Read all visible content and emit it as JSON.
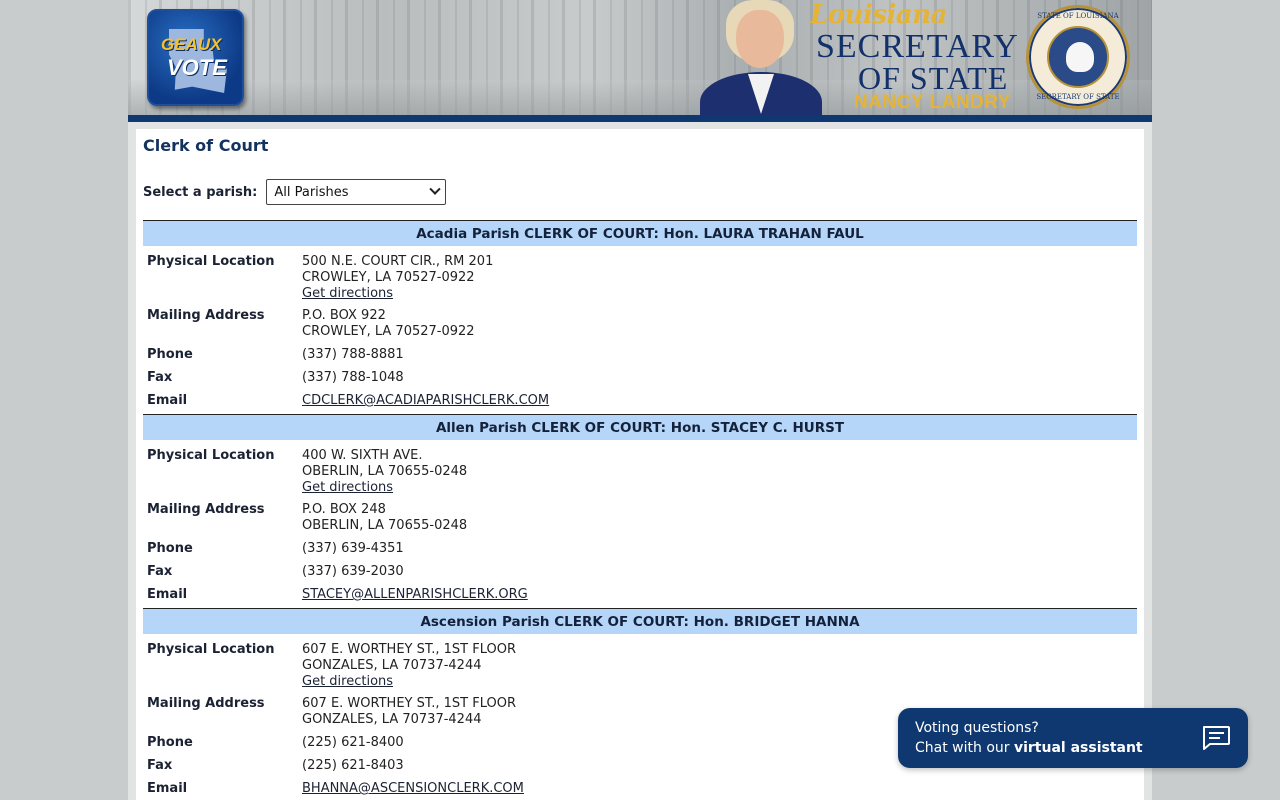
{
  "header": {
    "logo_line1": "GEAUX",
    "logo_line2": "VOTE",
    "sos_script": "Louisiana",
    "sos_line1": "SECRETARY",
    "sos_line2": "OF STATE",
    "sos_name": "NANCY LANDRY",
    "seal_top": "STATE OF LOUISIANA",
    "seal_bottom": "SECRETARY OF STATE"
  },
  "page": {
    "title": "Clerk of Court",
    "select_label": "Select a parish:",
    "select_value": "All Parishes"
  },
  "labels": {
    "physical": "Physical Location",
    "mailing": "Mailing Address",
    "phone": "Phone",
    "fax": "Fax",
    "email": "Email",
    "directions": "Get directions"
  },
  "parishes": [
    {
      "heading": "Acadia Parish CLERK OF COURT: Hon. LAURA TRAHAN FAUL",
      "phys1": "500 N.E. COURT CIR., RM 201",
      "phys2": "CROWLEY, LA 70527-0922",
      "mail1": "P.O. BOX 922",
      "mail2": "CROWLEY, LA 70527-0922",
      "phone": "(337) 788-8881",
      "fax": "(337) 788-1048",
      "email": "CDCLERK@ACADIAPARISHCLERK.COM"
    },
    {
      "heading": "Allen Parish CLERK OF COURT: Hon. STACEY C. HURST",
      "phys1": "400 W. SIXTH AVE.",
      "phys2": "OBERLIN, LA 70655-0248",
      "mail1": "P.O. BOX 248",
      "mail2": "OBERLIN, LA 70655-0248",
      "phone": "(337) 639-4351",
      "fax": "(337) 639-2030",
      "email": "STACEY@ALLENPARISHCLERK.ORG"
    },
    {
      "heading": "Ascension Parish CLERK OF COURT: Hon. BRIDGET HANNA",
      "phys1": "607 E. WORTHEY ST., 1ST FLOOR",
      "phys2": "GONZALES, LA 70737-4244",
      "mail1": "607 E. WORTHEY ST., 1ST FLOOR",
      "mail2": "GONZALES, LA 70737-4244",
      "phone": "(225) 621-8400",
      "fax": "(225) 621-8403",
      "email": "BHANNA@ASCENSIONCLERK.COM"
    }
  ],
  "chat": {
    "line1": "Voting questions?",
    "line2_prefix": "Chat with our",
    "line2_bold": "virtual assistant",
    "icon": "chat-bubble-icon"
  }
}
